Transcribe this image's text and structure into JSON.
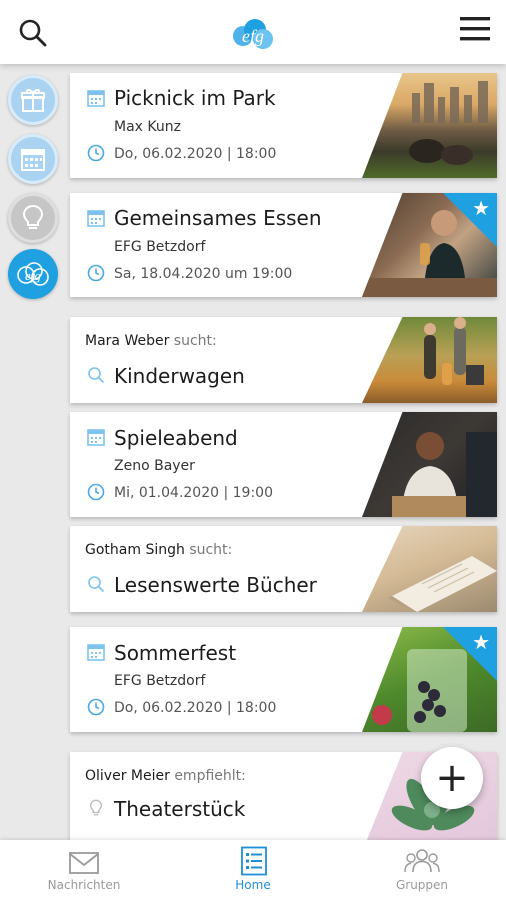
{
  "app": {
    "logo_text": "efg"
  },
  "header": {
    "search_icon": "search-icon",
    "menu_icon": "hamburger-menu-icon"
  },
  "rail": [
    {
      "name": "gift-icon"
    },
    {
      "name": "calendar-icon"
    },
    {
      "name": "lightbulb-icon"
    },
    {
      "name": "efg-logo-icon",
      "active": true
    }
  ],
  "cards": {
    "c1": {
      "title": "Picknick im Park",
      "organizer": "Max Kunz",
      "date": "Do, 06.02.2020 | 18:00"
    },
    "c2": {
      "title": "Gemeinsames Essen",
      "organizer": "EFG Betzdorf",
      "date": "Sa, 18.04.2020 um 19:00",
      "starred": true
    },
    "c3": {
      "person": "Mara Weber",
      "verb": "sucht:",
      "title": "Kinderwagen"
    },
    "c4": {
      "title": "Spieleabend",
      "organizer": "Zeno Bayer",
      "date": "Mi, 01.04.2020 | 19:00"
    },
    "c5": {
      "person": "Gotham Singh",
      "verb": "sucht:",
      "title": "Lesenswerte Bücher"
    },
    "c6": {
      "title": "Sommerfest",
      "organizer": "EFG Betzdorf",
      "date": "Do, 06.02.2020 | 18:00",
      "starred": true
    },
    "c7": {
      "person": "Oliver Meier",
      "verb": "empfiehlt:",
      "title": "Theaterstück"
    }
  },
  "fab": {
    "label": "+"
  },
  "bottom_nav": {
    "messages": "Nachrichten",
    "home": "Home",
    "groups": "Gruppen"
  },
  "colors": {
    "accent": "#1fa0e0",
    "background": "#e9e9e9"
  }
}
